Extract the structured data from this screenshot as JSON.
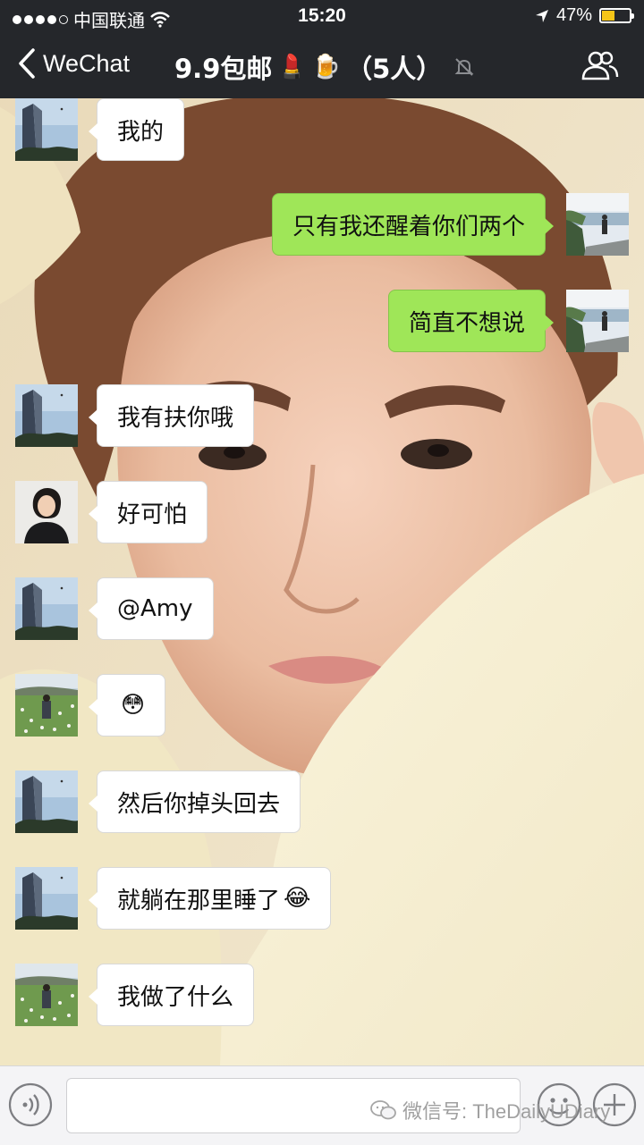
{
  "status_bar": {
    "carrier": "中国联通",
    "time": "15:20",
    "battery_percent": "47%",
    "battery_level": 0.47,
    "signal_bars_filled": 4
  },
  "nav": {
    "back_label": "WeChat",
    "title": "9.9包邮",
    "title_emojis": [
      "💄",
      "🍺"
    ],
    "member_count": "（5人）",
    "muted": true
  },
  "messages": [
    {
      "side": "left",
      "avatar": "building",
      "text": "我的"
    },
    {
      "side": "right",
      "avatar": "lake",
      "text": "只有我还醒着你们两个"
    },
    {
      "side": "right",
      "avatar": "lake",
      "text": "简直不想说"
    },
    {
      "side": "left",
      "avatar": "building",
      "text": "我有扶你哦"
    },
    {
      "side": "left",
      "avatar": "girl",
      "text": "好可怕"
    },
    {
      "side": "left",
      "avatar": "building",
      "text": "@Amy"
    },
    {
      "side": "left",
      "avatar": "field",
      "text": "",
      "emoji": "😳"
    },
    {
      "side": "left",
      "avatar": "building",
      "text": "然后你掉头回去"
    },
    {
      "side": "left",
      "avatar": "building",
      "text": "就躺在那里睡了",
      "emoji": "😂"
    },
    {
      "side": "left",
      "avatar": "field",
      "text": "我做了什么"
    }
  ],
  "input": {
    "value": "",
    "placeholder": ""
  },
  "watermark": "微信号: TheDailyUDiary",
  "colors": {
    "bar_bg": "#25272b",
    "out_bubble": "#9fe658",
    "in_bubble": "#ffffff",
    "battery": "#f5c518"
  },
  "icons": {
    "back": "chevron-left-icon",
    "mute": "bell-slash-icon",
    "members": "people-icon",
    "voice": "voice-icon",
    "emoji": "smiley-icon",
    "plus": "plus-icon",
    "wifi": "wifi-icon",
    "location": "location-arrow-icon"
  }
}
